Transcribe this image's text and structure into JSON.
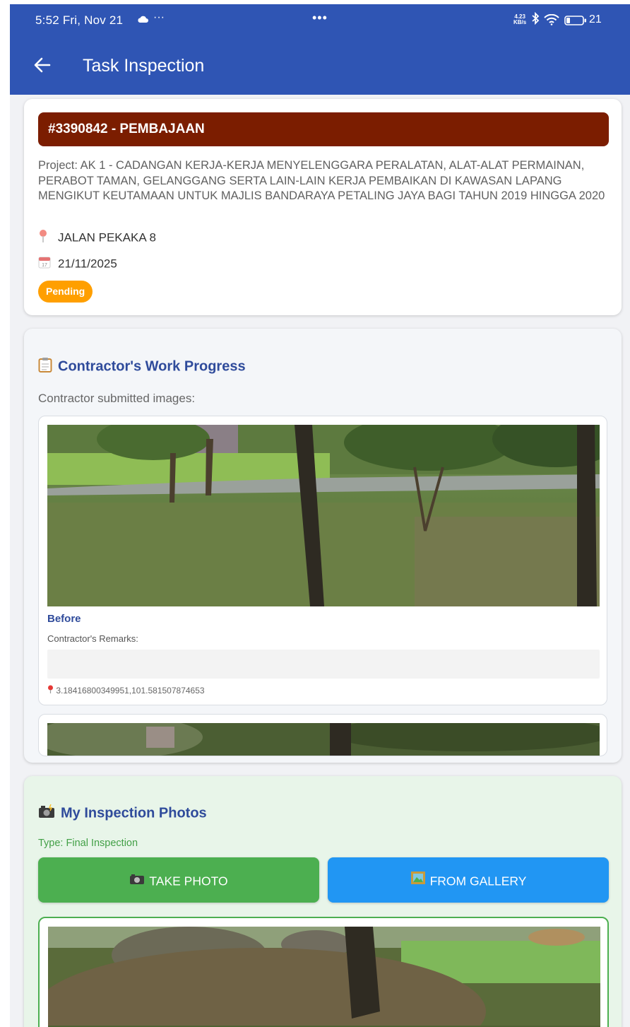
{
  "status_bar": {
    "time": "5:52",
    "date": "Fri, Nov 21",
    "overflow_dots": "···",
    "center_dots": "•••",
    "net_speed_value": "4.23",
    "net_speed_unit": "KB/s",
    "battery_percent": "21"
  },
  "app_bar": {
    "title": "Task Inspection"
  },
  "task": {
    "header": "#3390842 - PEMBAJAAN",
    "project": "Project: AK 1 - CADANGAN KERJA-KERJA MENYELENGGARA PERALATAN, ALAT-ALAT PERMAINAN, PERABOT TAMAN, GELANGGANG SERTA LAIN-LAIN KERJA PEMBAIKAN DI KAWASAN LAPANG MENGIKUT KEUTAMAAN UNTUK MAJLIS BANDARAYA PETALING JAYA BAGI TAHUN 2019 HINGGA 2020",
    "location": "JALAN PEKAKA 8",
    "date": "21/11/2025",
    "status": "Pending",
    "status_color": "#ff9f00",
    "header_color": "#7b1d00"
  },
  "contractor_progress": {
    "title": "Contractor's Work Progress",
    "subtitle": "Contractor submitted images:",
    "images": [
      {
        "label": "Before",
        "remarks_label": "Contractor's Remarks:",
        "remarks": "",
        "coordinates": "3.18416800349951,101.581507874653"
      }
    ]
  },
  "inspection_photos": {
    "title": "My Inspection Photos",
    "type": "Type: Final Inspection",
    "take_photo_label": "TAKE PHOTO",
    "gallery_label": "FROM GALLERY",
    "take_photo_color": "#4caf50",
    "gallery_color": "#2196f3"
  },
  "icons": {
    "back": "arrow-left-icon",
    "location": "map-pin-icon",
    "date": "calendar-icon",
    "progress": "clipboard-icon",
    "photos": "camera-flash-icon",
    "take_photo": "camera-icon",
    "gallery": "framed-picture-icon"
  },
  "theme": {
    "primary": "#2f55b4",
    "accent_text": "#2f4b9b"
  }
}
